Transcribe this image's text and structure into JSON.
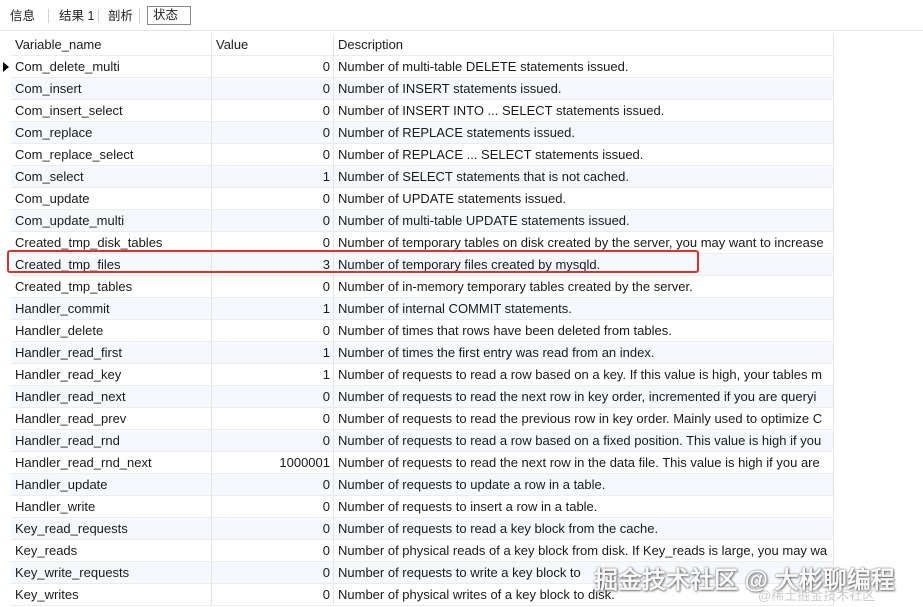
{
  "tabs": [
    {
      "label": "信息"
    },
    {
      "label": "结果 1"
    },
    {
      "label": "剖析"
    },
    {
      "label": "状态"
    }
  ],
  "columns": {
    "name": "Variable_name",
    "value": "Value",
    "description": "Description"
  },
  "rows": [
    {
      "name": "Com_delete_multi",
      "value": "0",
      "description": "Number of multi-table DELETE statements issued."
    },
    {
      "name": "Com_insert",
      "value": "0",
      "description": "Number of INSERT statements issued."
    },
    {
      "name": "Com_insert_select",
      "value": "0",
      "description": "Number of INSERT INTO ... SELECT statements issued."
    },
    {
      "name": "Com_replace",
      "value": "0",
      "description": "Number of REPLACE statements issued."
    },
    {
      "name": "Com_replace_select",
      "value": "0",
      "description": "Number of REPLACE ... SELECT statements issued."
    },
    {
      "name": "Com_select",
      "value": "1",
      "description": "Number of SELECT statements that is not cached."
    },
    {
      "name": "Com_update",
      "value": "0",
      "description": "Number of UPDATE statements issued."
    },
    {
      "name": "Com_update_multi",
      "value": "0",
      "description": "Number of multi-table UPDATE statements issued."
    },
    {
      "name": "Created_tmp_disk_tables",
      "value": "0",
      "description": "Number of temporary tables on disk created by the server, you may want to increase"
    },
    {
      "name": "Created_tmp_files",
      "value": "3",
      "description": "Number of temporary files created by mysqld."
    },
    {
      "name": "Created_tmp_tables",
      "value": "0",
      "description": "Number of in-memory temporary tables created by the server."
    },
    {
      "name": "Handler_commit",
      "value": "1",
      "description": "Number of internal COMMIT statements."
    },
    {
      "name": "Handler_delete",
      "value": "0",
      "description": "Number of times that rows have been deleted from tables."
    },
    {
      "name": "Handler_read_first",
      "value": "1",
      "description": "Number of times the first entry was read from an index."
    },
    {
      "name": "Handler_read_key",
      "value": "1",
      "description": "Number of requests to read a row based on a key. If this value is high, your tables m"
    },
    {
      "name": "Handler_read_next",
      "value": "0",
      "description": "Number of requests to read the next row in key order, incremented if you are queryi"
    },
    {
      "name": "Handler_read_prev",
      "value": "0",
      "description": "Number of requests to read the previous row in key order. Mainly used to optimize C"
    },
    {
      "name": "Handler_read_rnd",
      "value": "0",
      "description": "Number of requests to read a row based on a fixed position. This value is high if you"
    },
    {
      "name": "Handler_read_rnd_next",
      "value": "1000001",
      "description": "Number of requests to read the next row in the data file. This value is high if you are"
    },
    {
      "name": "Handler_update",
      "value": "0",
      "description": "Number of requests to update a row in a table."
    },
    {
      "name": "Handler_write",
      "value": "0",
      "description": "Number of requests to insert a row in a table."
    },
    {
      "name": "Key_read_requests",
      "value": "0",
      "description": "Number of requests to read a key block from the cache."
    },
    {
      "name": "Key_reads",
      "value": "0",
      "description": "Number of physical reads of a key block from disk. If Key_reads is large, you may wa"
    },
    {
      "name": "Key_write_requests",
      "value": "0",
      "description": "Number of requests to write a key block to"
    },
    {
      "name": "Key_writes",
      "value": "0",
      "description": "Number of physical writes of a key block to disk."
    }
  ],
  "highlight": {
    "row_name": "Created_tmp_files",
    "color": "#d9342b"
  },
  "watermark": {
    "main": "掘金技术社区 @ 大彬聊编程",
    "sub": "@稀土掘金技术社区"
  }
}
